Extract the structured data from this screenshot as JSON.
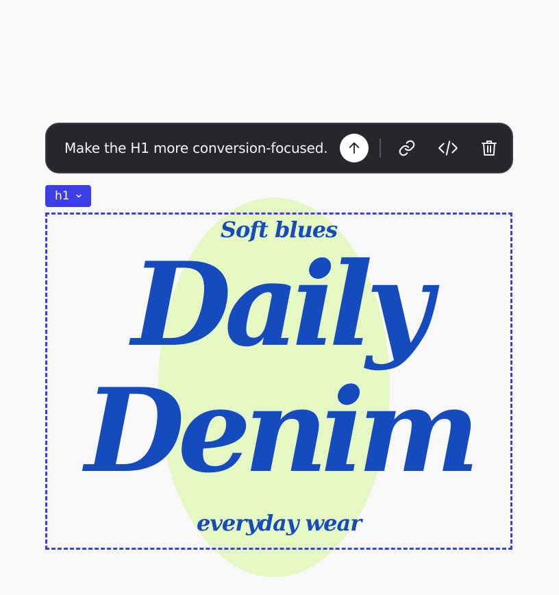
{
  "toolbar": {
    "prompt": "Make the H1 more conversion-focused.",
    "icons": {
      "send": "arrow-up-icon",
      "link": "link-icon",
      "code": "code-icon",
      "delete": "trash-icon"
    }
  },
  "element_tag": {
    "label": "h1",
    "icon": "chevron-down-icon"
  },
  "headline": {
    "kicker": "Soft blues",
    "line1": "Daily",
    "line2": "Denim",
    "footer": "everyday wear"
  },
  "colors": {
    "toolbar_bg": "#26272b",
    "accent": "#3c3ee5",
    "headline": "#154bbd",
    "blob": "#e5f8c4",
    "page_bg": "#f8f8f9"
  }
}
